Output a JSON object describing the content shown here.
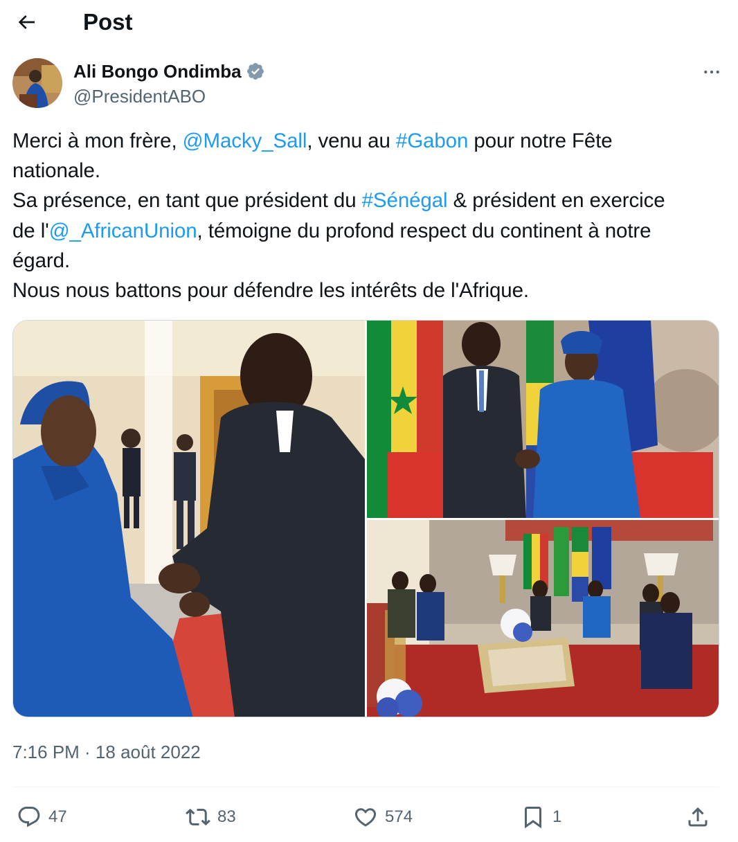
{
  "header": {
    "back_icon": "arrow-left-icon",
    "title": "Post"
  },
  "author": {
    "name": "Ali Bongo Ondimba",
    "handle": "@PresidentABO",
    "verified_icon": "verified-badge-icon",
    "more_icon": "more-horizontal-icon"
  },
  "tweet": {
    "l1_a": "Merci à mon frère, ",
    "l1_mention": "@Macky_Sall",
    "l1_b": ", venu au ",
    "l1_hashtag": "#Gabon",
    "l1_c": " pour notre Fête",
    "l2": "nationale.",
    "l3_a": "Sa présence, en tant que président du ",
    "l3_hashtag": "#Sénégal",
    "l3_b": " & président en exercice",
    "l4_a": "de l'",
    "l4_mention": "@_AfricanUnion",
    "l4_b": ", témoigne du profond respect du continent à notre",
    "l5": "égard.",
    "l6": "Nous nous battons pour défendre les intérêts de l'Afrique."
  },
  "timestamp": "7:16 PM · 18 août 2022",
  "actions": {
    "replies": "47",
    "reposts": "83",
    "likes": "574",
    "bookmarks": "1"
  },
  "colors": {
    "link": "#1d9bf0",
    "secondary_text": "#536471",
    "verified": "#829aab"
  }
}
